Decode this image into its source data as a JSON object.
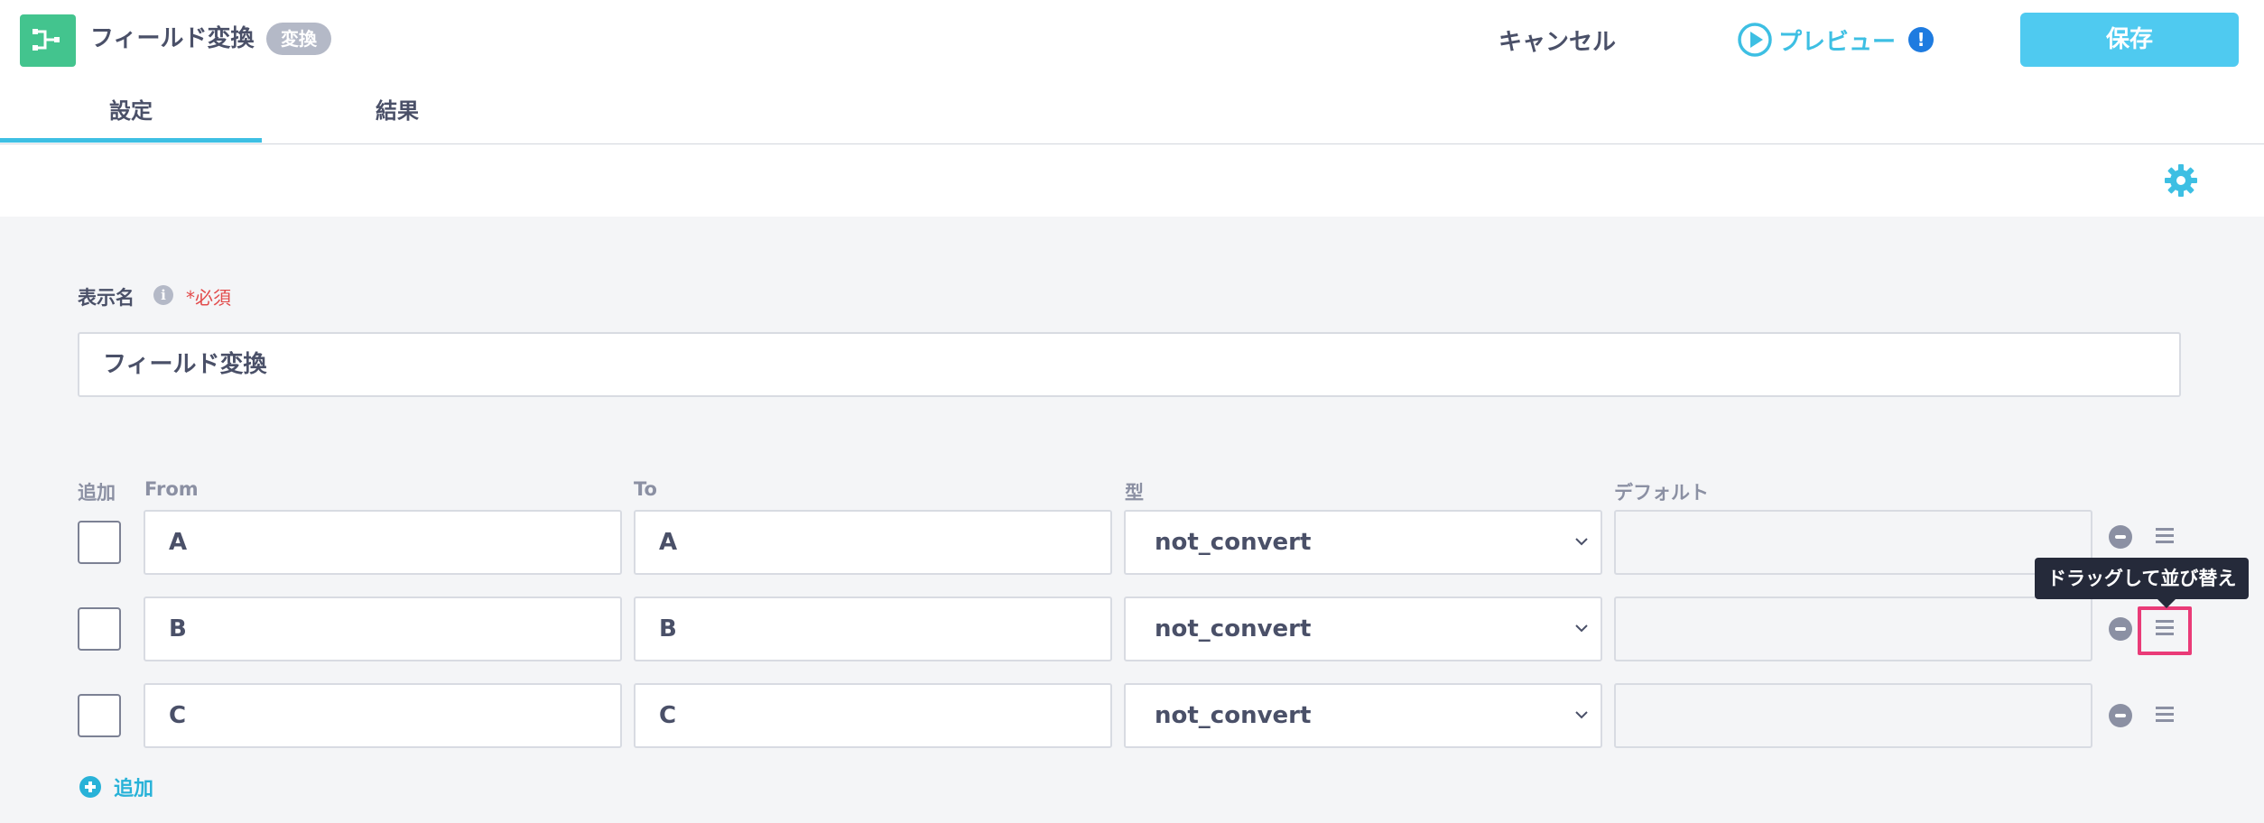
{
  "header": {
    "title": "フィールド変換",
    "badge": "変換",
    "cancel_label": "キャンセル",
    "preview_label": "プレビュー",
    "preview_alert": "!",
    "save_label": "保存"
  },
  "tabs": [
    {
      "label": "設定",
      "active": true
    },
    {
      "label": "結果",
      "active": false
    }
  ],
  "form": {
    "display_name_label": "表示名",
    "info_icon": "i",
    "required_label": "*必須",
    "display_name_value": "フィールド変換"
  },
  "table": {
    "columns": {
      "add": "追加",
      "from": "From",
      "to": "To",
      "type": "型",
      "default": "デフォルト"
    },
    "rows": [
      {
        "from": "A",
        "to": "A",
        "type": "not_convert",
        "default": ""
      },
      {
        "from": "B",
        "to": "B",
        "type": "not_convert",
        "default": ""
      },
      {
        "from": "C",
        "to": "C",
        "type": "not_convert",
        "default": ""
      }
    ],
    "drag_tooltip": "ドラッグして並び替え",
    "add_label": "追加"
  },
  "colors": {
    "accent": "#3dbfe3",
    "save": "#4fcaf0",
    "app_icon": "#43c48e",
    "required": "#e24b4b",
    "highlight": "#ea3b78"
  }
}
